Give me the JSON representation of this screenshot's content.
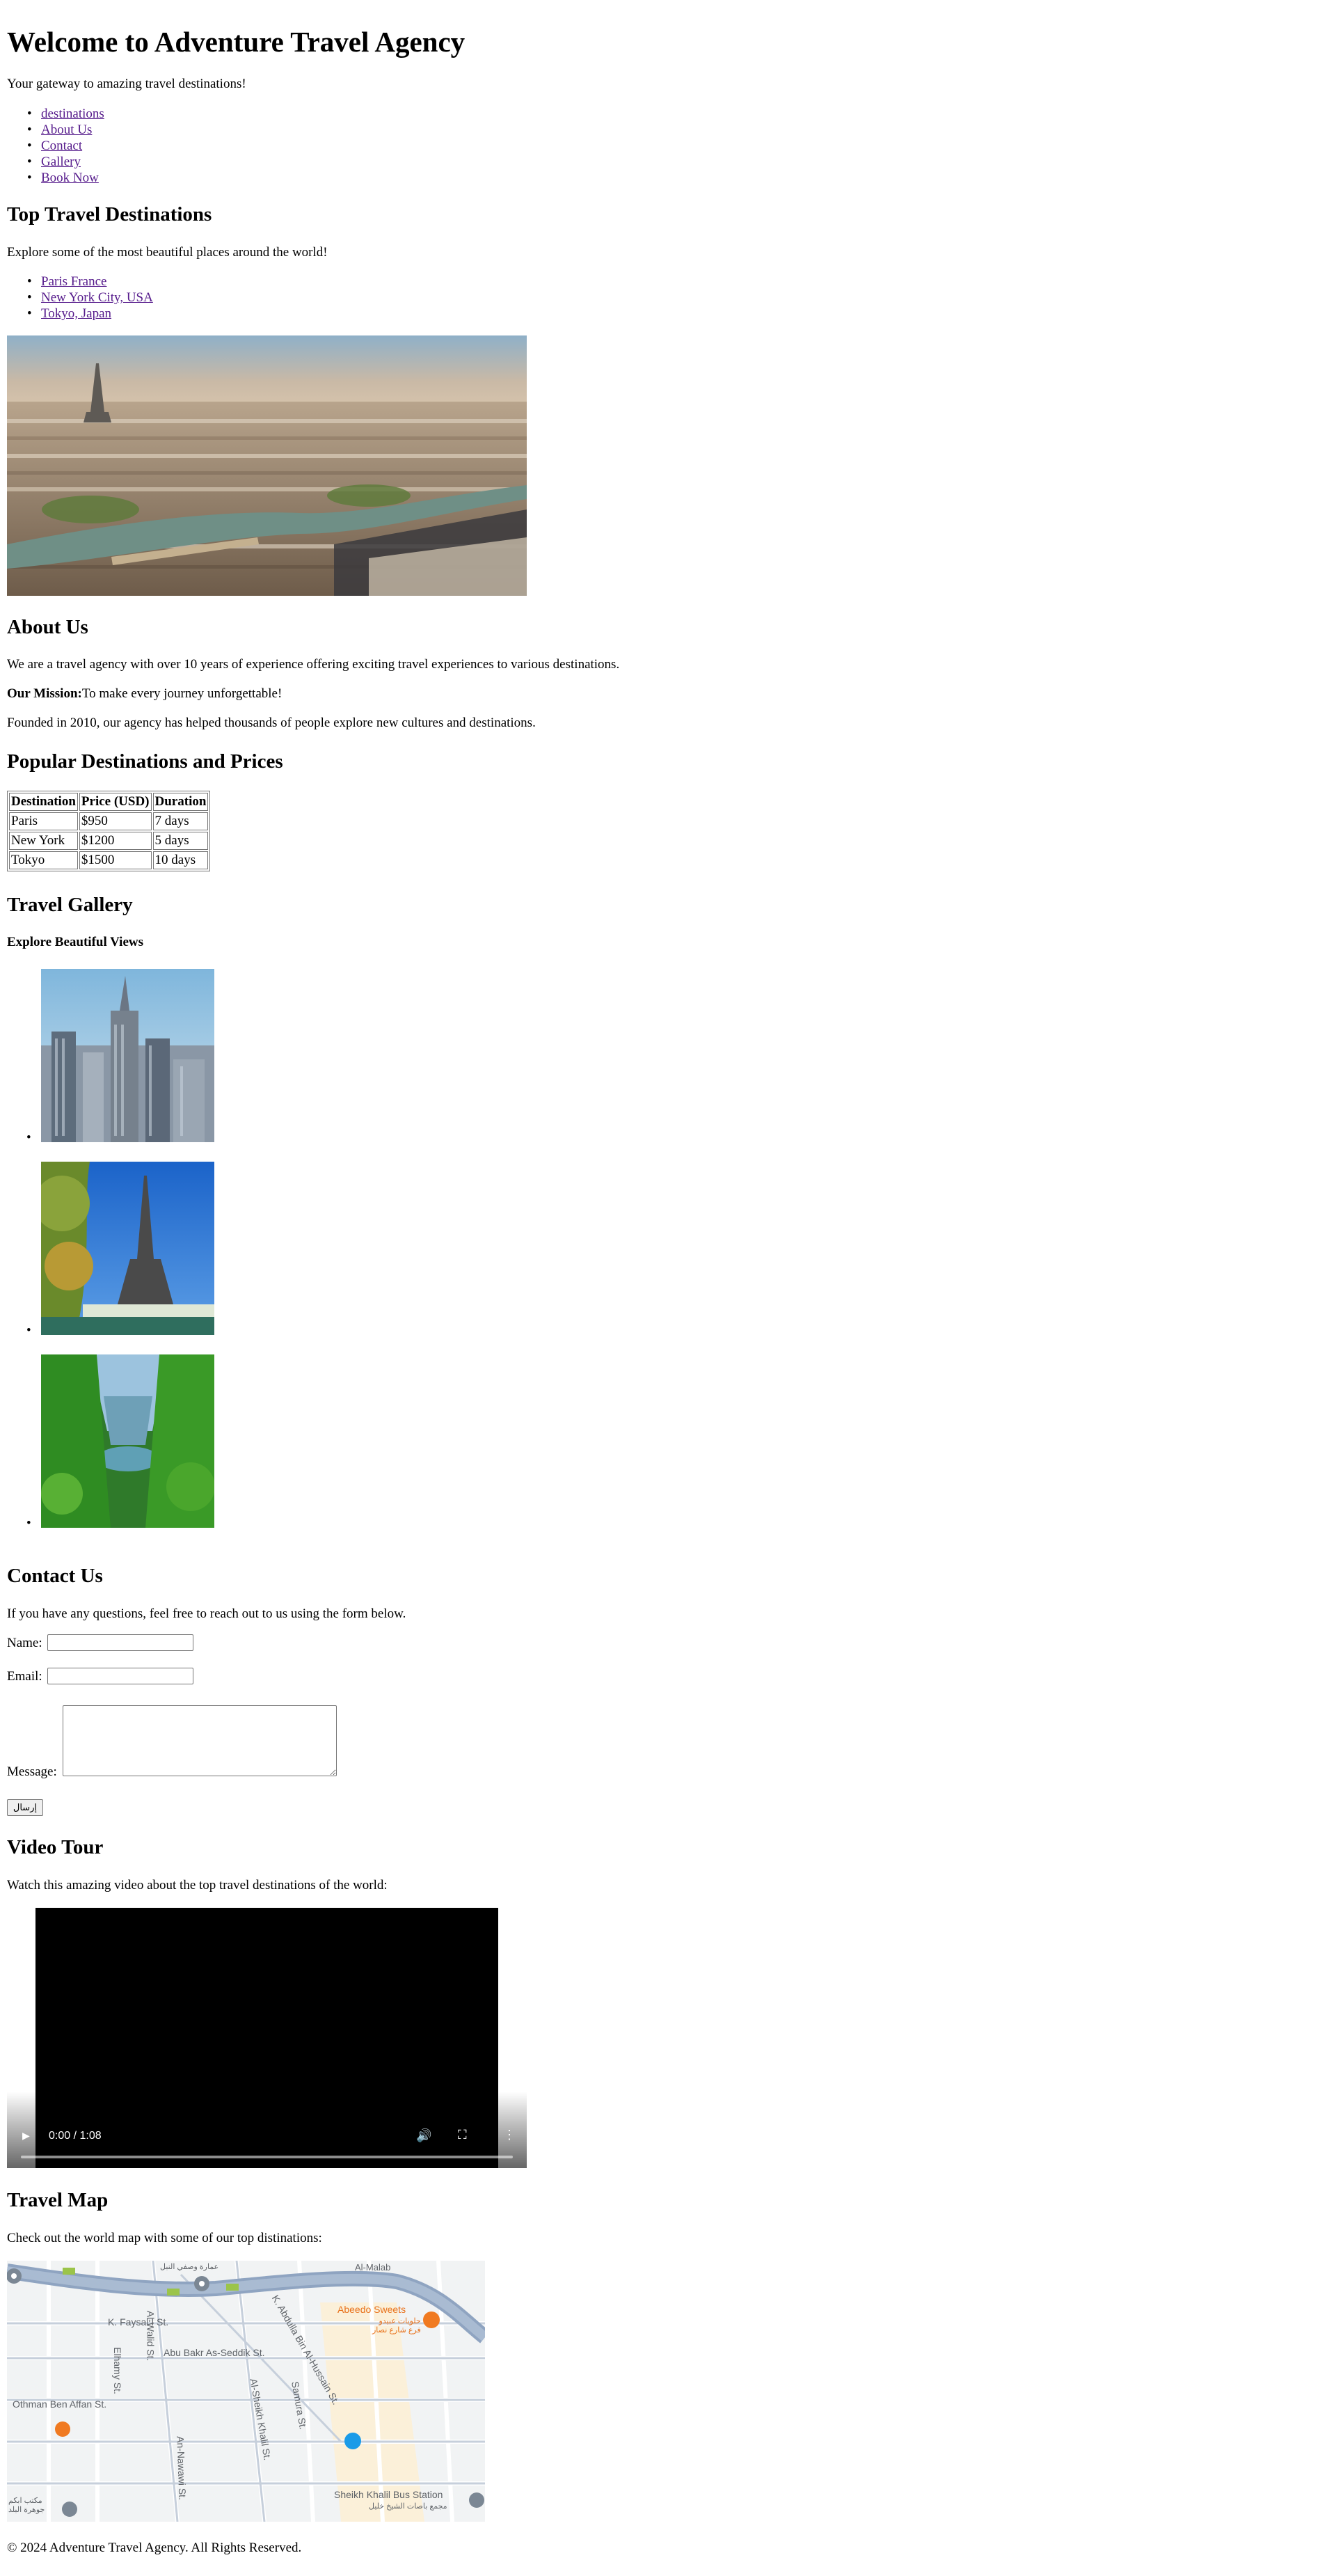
{
  "header": {
    "title": "Welcome to Adventure Travel Agency",
    "tagline": "Your gateway to amazing travel destinations!"
  },
  "nav": {
    "items": [
      "destinations",
      "About Us",
      "Contact",
      "Gallery",
      "Book Now"
    ]
  },
  "destinations": {
    "heading": "Top Travel Destinations",
    "intro": "Explore some of the most beautiful places around the world!",
    "links": [
      "Paris France",
      "New York City, USA",
      "Tokyo, Japan"
    ]
  },
  "about": {
    "heading": "About Us",
    "text": "We are a travel agency with over 10 years of experience offering exciting travel experiences to various destinations.",
    "mission_label": "Our Mission:",
    "mission_text": "To make every journey unforgettable!",
    "founded": "Founded in 2010, our agency has helped thousands of people explore new cultures and destinations."
  },
  "prices": {
    "heading": "Popular Destinations and Prices",
    "columns": [
      "Destination",
      "Price (USD)",
      "Duration"
    ],
    "rows": [
      [
        "Paris",
        "$950",
        "7 days"
      ],
      [
        "New York",
        "$1200",
        "5 days"
      ],
      [
        "Tokyo",
        "$1500",
        "10 days"
      ]
    ]
  },
  "gallery": {
    "heading": "Travel Gallery",
    "subheading": "Explore Beautiful Views"
  },
  "contact": {
    "heading": "Contact Us",
    "intro": "If you have any questions, feel free to reach out to us using the form below.",
    "name_label": "Name:",
    "email_label": "Email:",
    "message_label": "Message:",
    "submit_label": "إرسال"
  },
  "video": {
    "heading": "Video Tour",
    "intro": "Watch this amazing video about the top travel destinations of the world:",
    "time": "0:00 / 1:08",
    "progress": 0
  },
  "map": {
    "heading": "Travel Map",
    "intro": "Check out the world map with some of our top distinations:",
    "labels": {
      "faysal": "K. Faysal I St.",
      "seddik": "Abu Bakr As-Seddik St.",
      "othman": "Othman Ben Affan St.",
      "elhamy": "Elhamy St.",
      "walid": "Al-Walid St.",
      "khalil": "Al-Sheikh Khalil St.",
      "samura": "Samura St.",
      "nawawi": "An-Nawawi St.",
      "abdulla": "K. Abdulla Bin Al-Hussain St.",
      "sweets": "Abeedo Sweets",
      "sweets_ar": "حلويات عبيدو\nفرع شارع نصار",
      "bus_station": "Sheikh Khalil Bus Station",
      "bus_station_ar": "مجمع باصات الشيخ خليل",
      "top_ar": "عمارة وصفي النبل",
      "almalab": "Al-Malab",
      "bottom_ar": "مكتب ابكم\nجوهرة البلد"
    }
  },
  "footer": {
    "text": "© 2024 Adventure Travel Agency. All Rights Reserved."
  },
  "colors": {
    "link": "#551a8b",
    "map_road": "#8fa4c1",
    "poi_orange": "#f07a21",
    "poi_blue": "#1a9be8"
  }
}
